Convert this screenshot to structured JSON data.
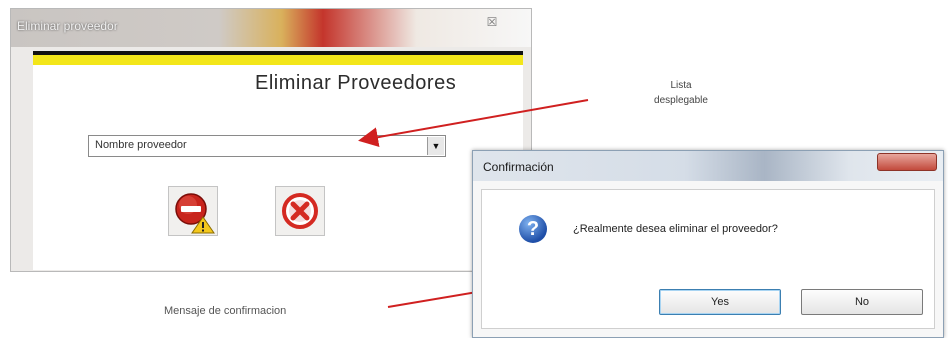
{
  "main_dialog": {
    "title": "Eliminar proveedor",
    "close_glyph": "☒",
    "heading": "Eliminar Proveedores",
    "dropdown": {
      "value": "Nombre proveedor",
      "arrow": "▼"
    }
  },
  "annotations": {
    "lista_line1": "Lista",
    "lista_line2": "desplegable",
    "mensaje": "Mensaje de confirmacion"
  },
  "confirm_dialog": {
    "title": "Confirmación",
    "question_glyph": "?",
    "message": "¿Realmente desea eliminar el proveedor?",
    "yes_label": "Yes",
    "no_label": "No"
  },
  "colors": {
    "arrow_red": "#d02020",
    "yellow_bar": "#f3e61a"
  },
  "icons": {
    "delete": "no-entry-warning-icon",
    "cancel": "red-x-cancel-icon",
    "question": "question-icon"
  }
}
